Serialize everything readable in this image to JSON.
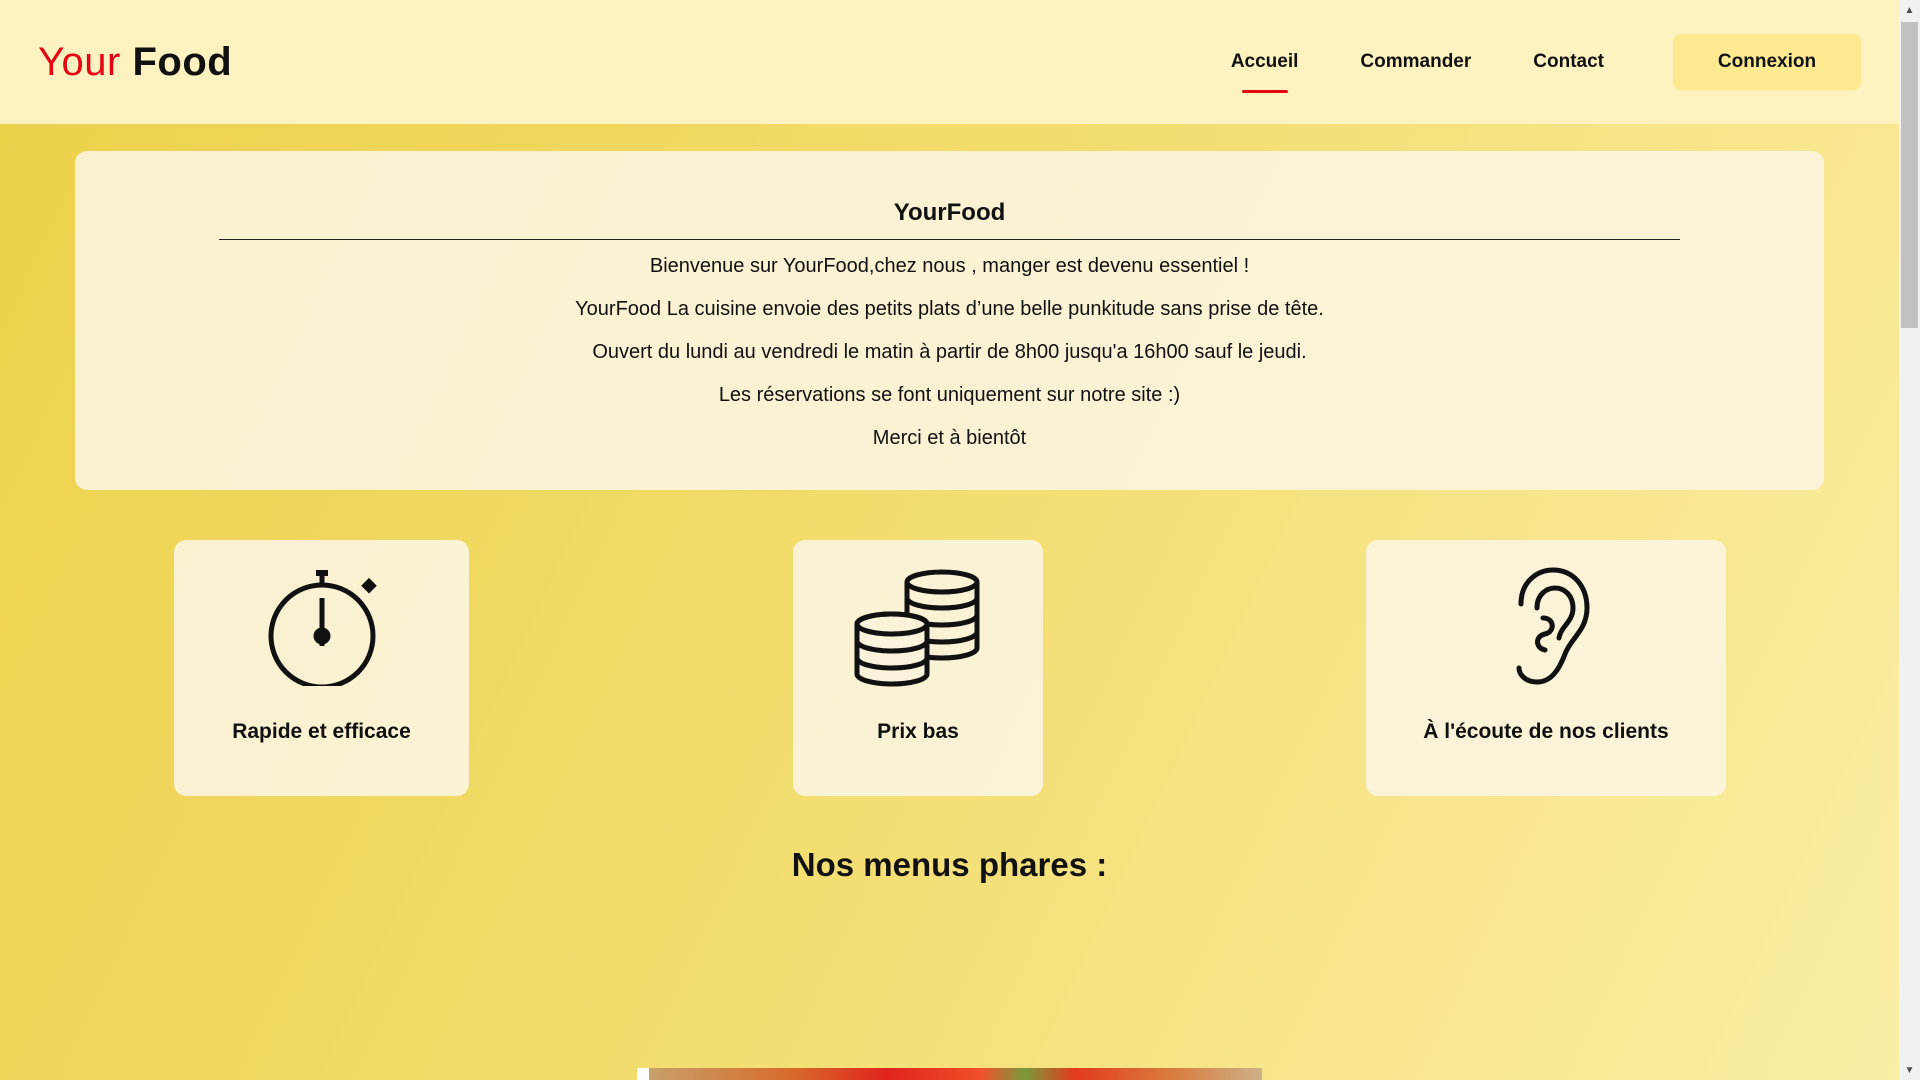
{
  "header": {
    "logo_part1": "Your",
    "logo_part2": "Food",
    "nav": [
      {
        "label": "Accueil",
        "active": true
      },
      {
        "label": "Commander",
        "active": false
      },
      {
        "label": "Contact",
        "active": false
      }
    ],
    "login_label": "Connexion"
  },
  "intro": {
    "title": "YourFood",
    "lines": [
      "Bienvenue sur YourFood,chez nous , manger est devenu essentiel !",
      "YourFood La cuisine envoie des petits plats d’une belle punkitude sans prise de tête.",
      "Ouvert du lundi au vendredi le matin à partir de 8h00 jusqu'a 16h00 sauf le jeudi.",
      "Les réservations se font uniquement sur notre site :)",
      "Merci et à bientôt"
    ]
  },
  "features": [
    {
      "icon": "stopwatch-icon",
      "label": "Rapide et efficace"
    },
    {
      "icon": "coins-icon",
      "label": "Prix bas"
    },
    {
      "icon": "ear-icon",
      "label": "À l'écoute de nos clients"
    }
  ],
  "menus": {
    "title": "Nos menus phares :"
  },
  "colors": {
    "accent_red": "#e30613",
    "header_bg": "#fef3c0",
    "button_bg": "#fde98f"
  }
}
